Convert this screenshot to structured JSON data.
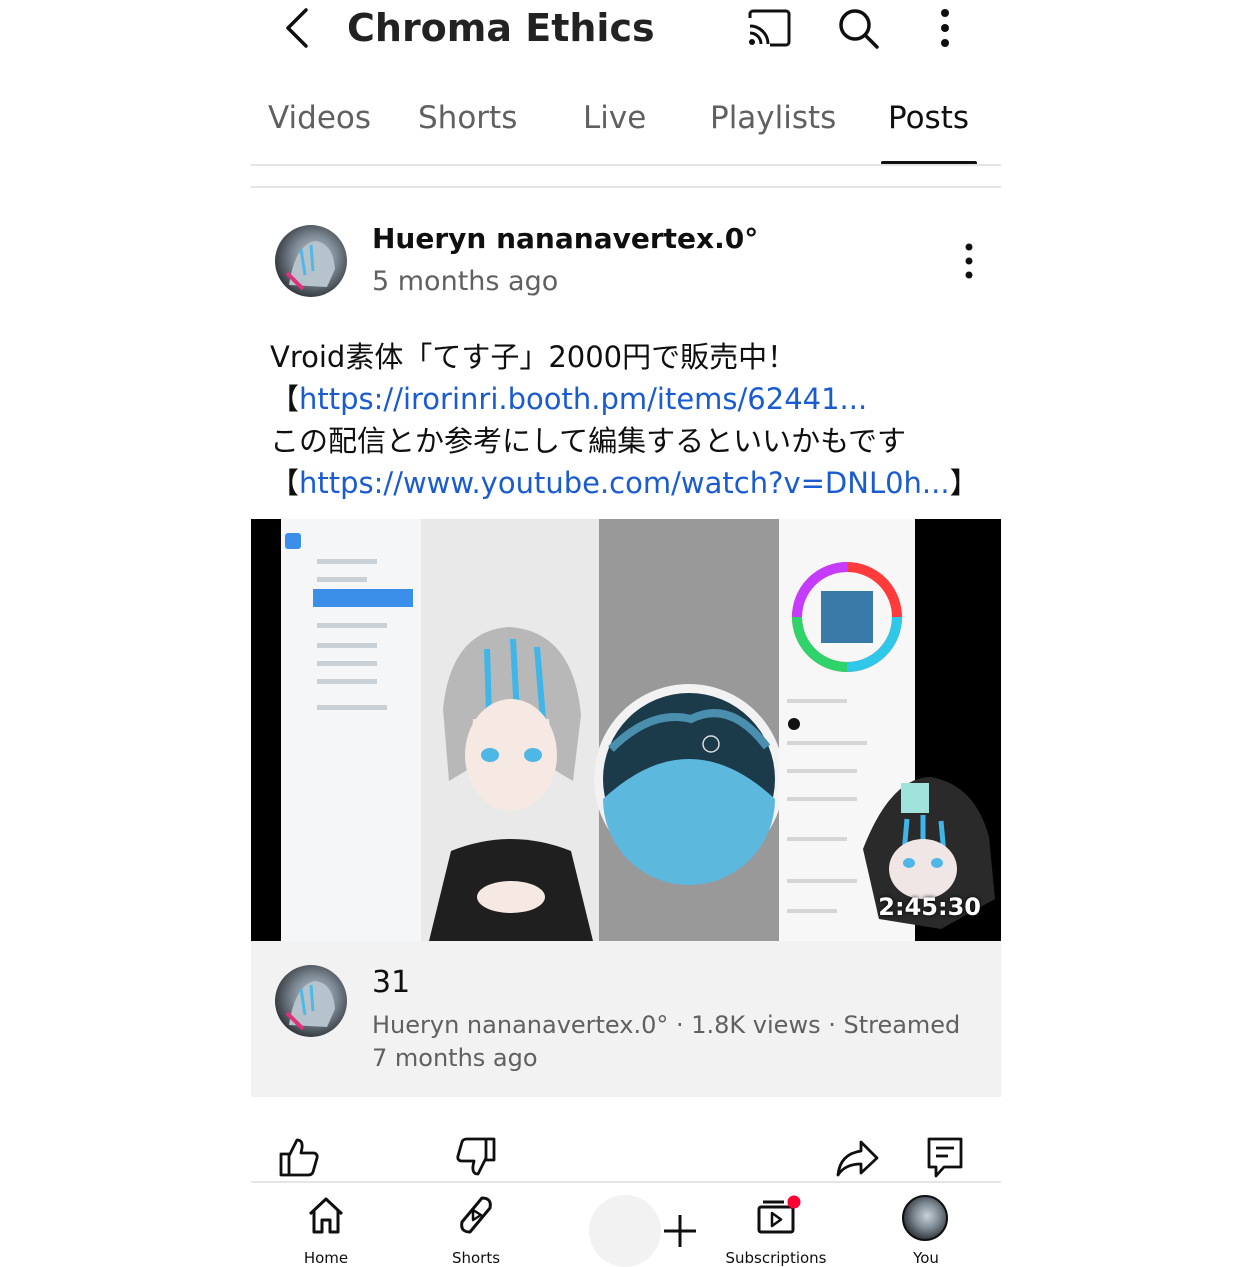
{
  "header": {
    "channel_title": "Chroma Ethics",
    "icons": [
      "back-arrow-icon",
      "cast-icon",
      "search-icon",
      "more-vert-icon"
    ]
  },
  "tabs": [
    {
      "label": "Videos",
      "active": false
    },
    {
      "label": "Shorts",
      "active": false
    },
    {
      "label": "Live",
      "active": false
    },
    {
      "label": "Playlists",
      "active": false
    },
    {
      "label": "Posts",
      "active": true
    }
  ],
  "post": {
    "author": "Hueryn nananavertex.0°",
    "time": "5 months ago",
    "line1": "Vroid素体「てす子」2000円で販売中！",
    "line2_prefix": "【",
    "line2_link": "https://irorinri.booth.pm/items/62441...",
    "line3": "この配信とか参考にして編集するといいかもです",
    "line4_prefix": "【",
    "line4_link": "https://www.youtube.com/watch?v=DNL0h...",
    "line4_suffix": "】"
  },
  "video": {
    "duration": "2:45:30",
    "title": "31",
    "meta": "Hueryn nananavertex.0° · 1.8K views · Streamed 7 months ago"
  },
  "actions": [
    "like-icon",
    "dislike-icon",
    "share-icon",
    "comment-icon"
  ],
  "bottom_nav": [
    {
      "label": "Home",
      "icon": "home-icon"
    },
    {
      "label": "Shorts",
      "icon": "shorts-icon"
    },
    {
      "label": "",
      "icon": "plus-icon"
    },
    {
      "label": "Subscriptions",
      "icon": "subscriptions-icon"
    },
    {
      "label": "You",
      "icon": "avatar"
    }
  ],
  "colors": {
    "link": "#1a5ccf",
    "notification_dot": "#ff0033",
    "text_secondary": "#606060"
  }
}
